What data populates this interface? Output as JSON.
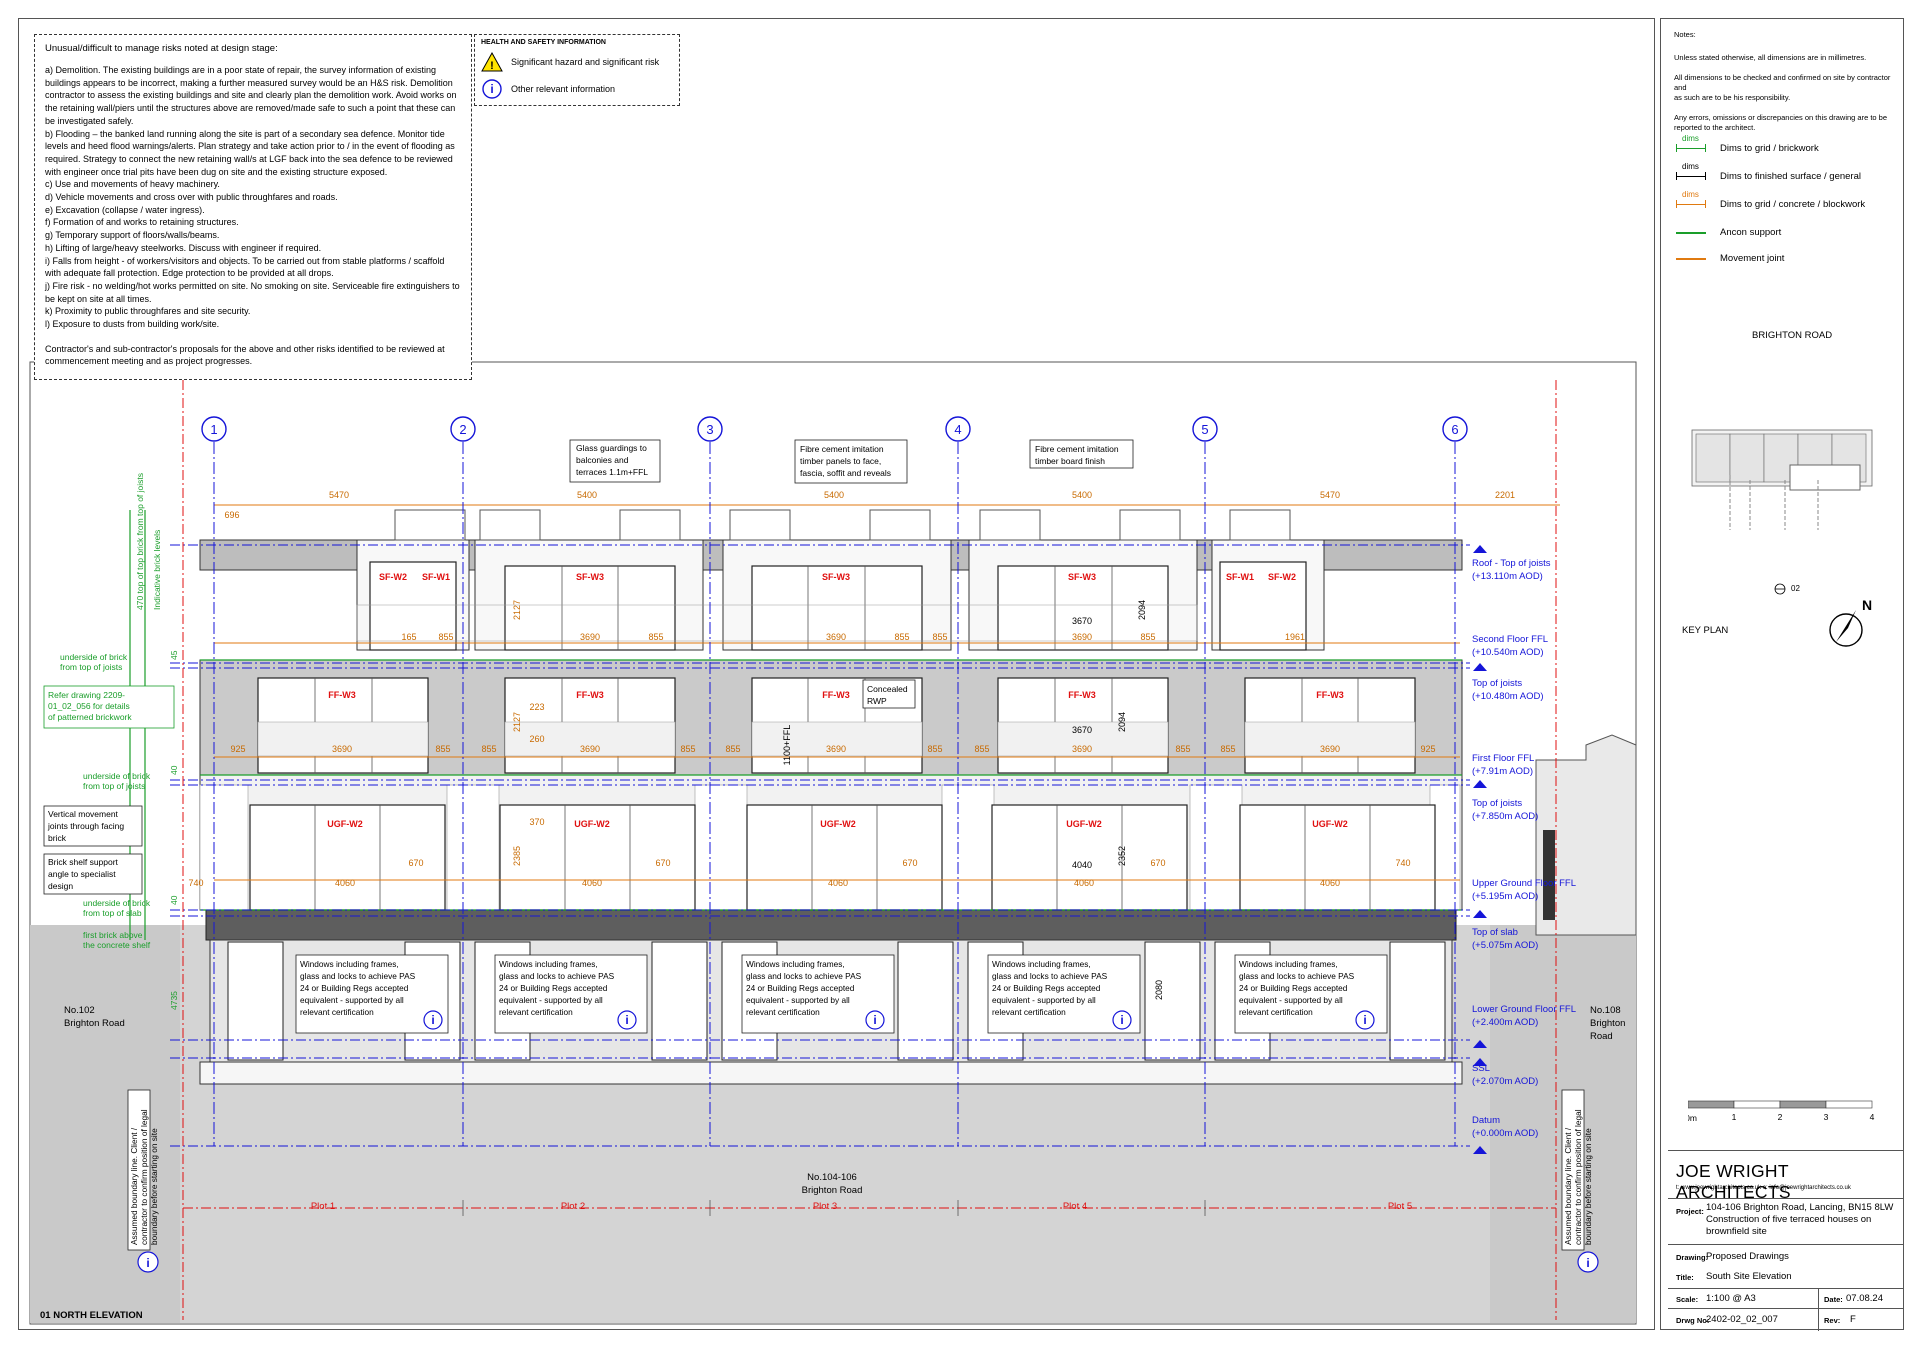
{
  "risk_notes": {
    "title": "Unusual/difficult to manage risks noted at design stage:",
    "items": [
      "a) Demolition. The existing buildings are in a poor state of repair, the survey information of existing",
      "buildings appears to be incorrect, making a further measured survey would be an H&S risk. Demolition",
      "contractor to assess the existing buildings and site and clearly plan the demolition work. Avoid works on",
      "the retaining wall/piers until the structures above are removed/made safe to such a point that these can",
      "be investigated safely.",
      "b) Flooding – the banked land running along the site is part of a secondary sea defence. Monitor tide",
      "levels and heed flood warnings/alerts. Plan strategy and take action prior to / in the event of flooding as",
      "required. Strategy to connect the new retaining wall/s at LGF back into the sea defence to be reviewed",
      "with engineer once trial pits have been dug on site and the existing structure exposed.",
      "c) Use and movements of heavy machinery.",
      "d) Vehicle movements and cross over with public throughfares and roads.",
      "e) Excavation (collapse / water ingress).",
      "f) Formation of and works to retaining structures.",
      "g) Temporary support of floors/walls/beams.",
      "h) Lifting of large/heavy steelworks. Discuss with engineer if required.",
      "i) Falls from height - of workers/visitors and objects. To be carried out from stable platforms / scaffold",
      "with adequate fall protection. Edge protection to be provided at all drops.",
      "j) Fire risk - no welding/hot works permitted on site. No smoking on site. Serviceable fire extinguishers to",
      "be kept on site at all times.",
      "k) Proximity to public throughfares and site security.",
      "l) Exposure to dusts from building work/site."
    ],
    "footer_1": "Contractor's and sub-contractor's proposals for the above and other risks identified to be reviewed at",
    "footer_2": "commencement meeting and as project progresses."
  },
  "hs_box": {
    "title": "HEALTH AND SAFETY INFORMATION",
    "hazard": "Significant hazard and significant risk",
    "info": "Other relevant information",
    "info_glyph": "i"
  },
  "notes": {
    "title": "Notes:",
    "line1": "Unless stated otherwise, all dimensions are in millimetres.",
    "line2a": "All dimensions to be checked and confirmed on site by contractor and",
    "line2b": "as such are to be his responsibility.",
    "line3a": "Any errors, omissions or discrepancies on this drawing are to be",
    "line3b": "reported to the architect."
  },
  "legend": [
    {
      "sym": "dims",
      "label": "Dims to grid / brickwork",
      "color": "#1a9e2a"
    },
    {
      "sym": "dims",
      "label": "Dims to finished surface / general",
      "color": "#000000"
    },
    {
      "sym": "dims",
      "label": "Dims to grid / concrete / blockwork",
      "color": "#e07a10"
    },
    {
      "sym": "",
      "label": "Ancon support",
      "color": "#1a9e2a"
    },
    {
      "sym": "",
      "label": "Movement joint",
      "color": "#e07a10"
    }
  ],
  "key_plan": {
    "road": "BRIGHTON ROAD",
    "label": "KEY PLAN",
    "ref": "02",
    "north": "N"
  },
  "scale_bar": {
    "labels": [
      "0m",
      "1",
      "2",
      "3",
      "4"
    ]
  },
  "title_block": {
    "firm": "JOE WRIGHT ARCHITECTS",
    "contact": "t: www.joewrightarchitects.co.uk  e: info@joewrightarchitects.co.uk",
    "project_label": "Project:",
    "project_1": "104-106 Brighton Road, Lancing, BN15 8LW",
    "project_2": "Construction of five terraced houses on",
    "project_3": "brownfield site",
    "drawing_label": "Drawing:",
    "drawing": "Proposed Drawings",
    "title_label": "Title:",
    "title": "South Site Elevation",
    "scale_label": "Scale:",
    "scale": "1:100 @ A3",
    "date_label": "Date:",
    "date": "07.08.24",
    "drgno_label": "Drwg No:",
    "drgno": "2402-02_02_007",
    "rev_label": "Rev:",
    "rev": "F"
  },
  "drawing": {
    "grids": [
      "1",
      "2",
      "3",
      "4",
      "5",
      "6"
    ],
    "top_dims": [
      "5470",
      "5400",
      "5400",
      "5400",
      "5470",
      "2201"
    ],
    "first_offset": "696",
    "callouts": {
      "glass": [
        "Glass guardings to",
        "balconies and",
        "terraces 1.1m+FFL"
      ],
      "fibre_panels": [
        "Fibre cement imitation",
        "timber panels to face,",
        "fascia, soffit and reveals"
      ],
      "fibre_board": [
        "Fibre cement imitation",
        "timber board finish"
      ],
      "concealed": [
        "Concealed",
        "RWP"
      ]
    },
    "levels": [
      {
        "a": "Roof - Top of joists",
        "b": "(+13.110m AOD)"
      },
      {
        "a": "Second Floor FFL",
        "b": "(+10.540m AOD)"
      },
      {
        "a": "Top of joists",
        "b": "(+10.480m AOD)"
      },
      {
        "a": "First Floor FFL",
        "b": "(+7.91m AOD)"
      },
      {
        "a": "Top of joists",
        "b": "(+7.850m AOD)"
      },
      {
        "a": "Upper Ground Floor FFL",
        "b": "(+5.195m AOD)"
      },
      {
        "a": "Top of slab",
        "b": "(+5.075m AOD)"
      },
      {
        "a": "Lower Ground Floor FFL",
        "b": "(+2.400m AOD)"
      },
      {
        "a": "SSL",
        "b": "(+2.070m AOD)"
      },
      {
        "a": "Datum",
        "b": "(+0.000m AOD)"
      }
    ],
    "left_notes": {
      "vert_dim_1": "470 top of top brick from top of joists",
      "vert_dim_2": "Indicative brick levels",
      "und1": [
        "underside of brick",
        "from top of joists"
      ],
      "refer": [
        "Refer drawing 2209-",
        "01_02_056 for details",
        "of patterned brickwork"
      ],
      "und2": [
        "underside of brick",
        "from top of joists"
      ],
      "vertical_joint": [
        "Vertical movement",
        "joints through facing",
        "brick"
      ],
      "brick_shelf": [
        "Brick shelf support",
        "angle to specialist",
        "design"
      ],
      "und3": [
        "underside of brick",
        "from top of slab"
      ],
      "first_brick": [
        "first brick above",
        "the concrete shelf"
      ],
      "dim_4735": "4735",
      "dim_40": "40",
      "dim_45": "45"
    },
    "window_tags": {
      "sf_w1": "SF-W1",
      "sf_w2": "SF-W2",
      "sf_w3": "SF-W3",
      "ff_w3": "FF-W3",
      "ugf_w2": "UGF-W2",
      "tag": "sl"
    },
    "window_dims": {
      "d3690": "3690",
      "d855": "855",
      "d925": "925",
      "d4060": "4060",
      "d670": "670",
      "d740": "740",
      "d3670": "3670",
      "d4040": "4040",
      "d2094": "2094",
      "d2127": "2127",
      "d2385": "2385",
      "d2352": "2352",
      "d2080": "2080",
      "d1961": "1961",
      "d165": "165",
      "d223": "223",
      "d260": "260",
      "d370": "370",
      "d1100": "1100+FFL"
    },
    "window_note": [
      "Windows including frames,",
      "glass and locks to achieve PAS",
      "24 or Building Regs accepted",
      "equivalent - supported by all",
      "relevant certification"
    ],
    "neighbours": {
      "left": [
        "No.102",
        "Brighton Road"
      ],
      "right": [
        "No.108",
        "Brighton",
        "Road"
      ],
      "centre": [
        "No.104-106",
        "Brighton Road"
      ]
    },
    "boundary_note": [
      "Assumed boundary line. Client /",
      "contractor to confirm position of legal",
      "boundary before starting on site"
    ],
    "plots": [
      "Plot 1",
      "Plot 2",
      "Plot 3",
      "Plot 4",
      "Plot 5"
    ],
    "view_title": "01 NORTH ELEVATION"
  },
  "colors": {
    "grid": "#1515d8",
    "tag_red": "#e01010",
    "dim_orange": "#c86a00",
    "green": "#1a9e2a",
    "boundary_red": "#e01010"
  }
}
